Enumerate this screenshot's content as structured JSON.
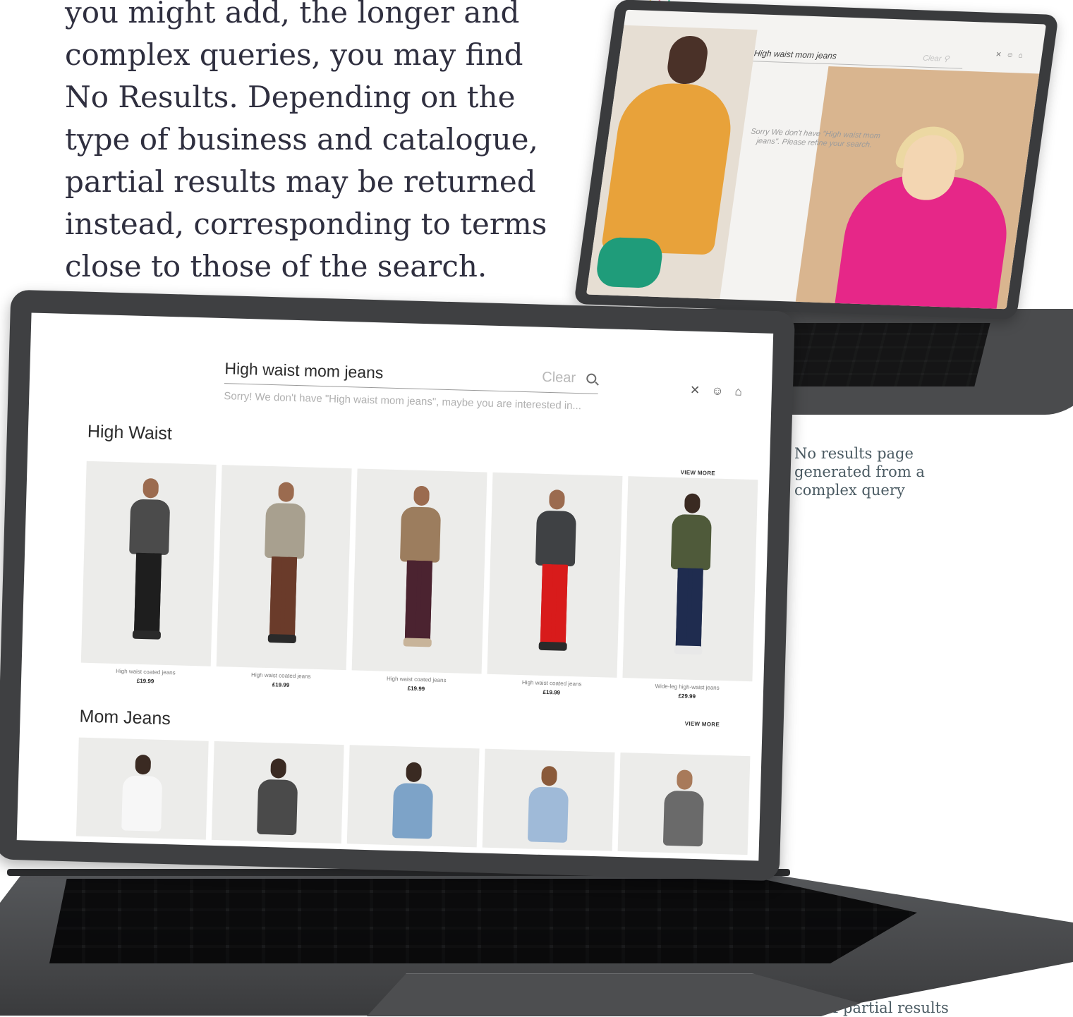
{
  "article": {
    "intro_lines": [
      "you might add, the longer and",
      "complex queries, you may find",
      "No Results. Depending on the",
      "type of business and catalogue,",
      "partial results may be returned",
      "instead, corresponding to terms",
      "close to those of the search."
    ],
    "caption_no_results": "No results page generated from a complex query",
    "caption_partial": "Set of partial results"
  },
  "back_screen": {
    "search_value": "High waist mom jeans",
    "clear_label": "Clear",
    "message": "Sorry We don't have \"High waist mom jeans\". Please refine your search."
  },
  "front_screen": {
    "search_value": "High waist mom jeans",
    "clear_label": "Clear",
    "sorry_text": "Sorry! We don't have \"High waist mom jeans\", maybe you are interested in...",
    "sections": [
      {
        "title": "High Waist",
        "view_more": "VIEW MORE",
        "products": [
          {
            "name": "High waist coated jeans",
            "price": "£19.99"
          },
          {
            "name": "High waist coated jeans",
            "price": "£19.99"
          },
          {
            "name": "High waist coated jeans",
            "price": "£19.99"
          },
          {
            "name": "High waist coated jeans",
            "price": "£19.99"
          },
          {
            "name": "Wide-leg high-waist jeans",
            "price": "£29.99"
          }
        ]
      },
      {
        "title": "Mom Jeans",
        "view_more": "VIEW MORE"
      }
    ]
  },
  "colors": {
    "accent_lines": [
      "#ec6f9a",
      "#f2c64c",
      "#58c7a4"
    ]
  }
}
